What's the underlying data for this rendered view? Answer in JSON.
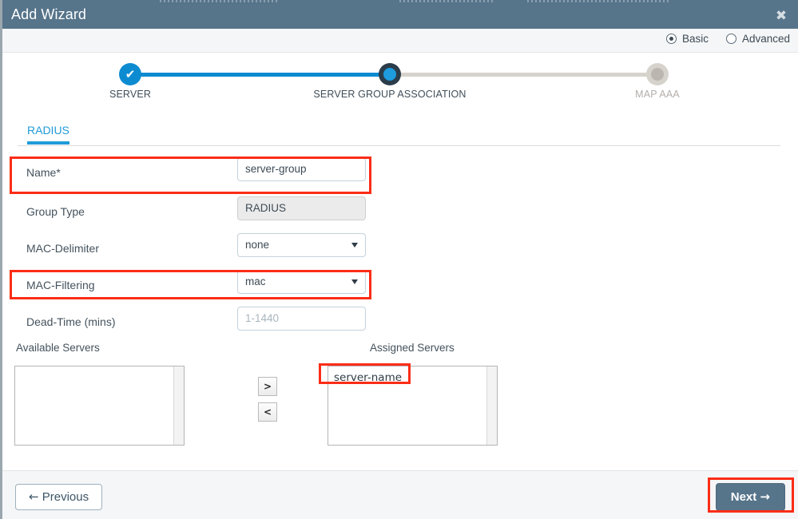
{
  "window": {
    "title": "Add Wizard",
    "close_icon": "close-icon",
    "close_glyph": "✖"
  },
  "mode": {
    "options": [
      {
        "label": "Basic",
        "checked": true
      },
      {
        "label": "Advanced",
        "checked": false
      }
    ]
  },
  "stepper": {
    "steps": [
      {
        "label": "SERVER",
        "state": "complete",
        "glyph": "✔"
      },
      {
        "label": "SERVER GROUP ASSOCIATION",
        "state": "current",
        "glyph": ""
      },
      {
        "label": "MAP AAA",
        "state": "upcoming",
        "glyph": ""
      }
    ]
  },
  "tabs": [
    {
      "label": "RADIUS",
      "active": true
    }
  ],
  "form": {
    "fields": [
      {
        "label": "Name*",
        "value": "server-group",
        "type": "text",
        "highlighted": true
      },
      {
        "label": "Group Type",
        "value": "RADIUS",
        "type": "readonly",
        "highlighted": false
      },
      {
        "label": "MAC-Delimiter",
        "value": "none",
        "type": "select",
        "highlighted": false
      },
      {
        "label": "MAC-Filtering",
        "value": "mac",
        "type": "select",
        "highlighted": true
      },
      {
        "label": "Dead-Time (mins)",
        "value": "1-1440",
        "type": "placeholder",
        "highlighted": false
      }
    ]
  },
  "dual_list": {
    "available_title": "Available Servers",
    "assigned_title": "Assigned Servers",
    "available_items": [],
    "assigned_items": [
      "server-name"
    ],
    "move_right_label": ">",
    "move_left_label": "<"
  },
  "footer": {
    "previous_label": "Previous",
    "previous_icon": "arrow-left-icon",
    "previous_glyph": "←",
    "next_label": "Next",
    "next_icon": "arrow-right-icon",
    "next_glyph": "→"
  },
  "colors": {
    "titlebar": "#56748a",
    "accent_blue": "#1f9bd8",
    "step_done": "#0d8bd1",
    "step_todo": "#d6d2cc",
    "highlight_red": "#fb2d17",
    "next_button": "#56748a"
  }
}
